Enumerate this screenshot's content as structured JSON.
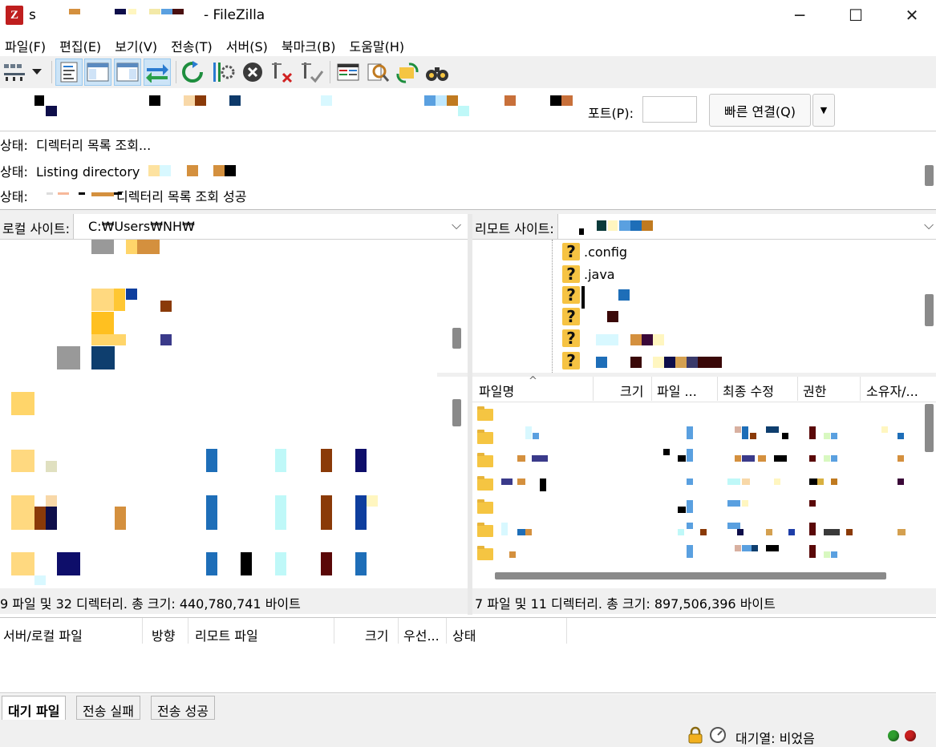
{
  "window": {
    "title_prefix": "s",
    "title_suffix": "- FileZilla",
    "app_icon": "Z",
    "minimize": "─",
    "maximize": "☐",
    "close": "✕"
  },
  "menu": [
    "파일(F)",
    "편집(E)",
    "보기(V)",
    "전송(T)",
    "서버(S)",
    "북마크(B)",
    "도움말(H)"
  ],
  "toolbar": {
    "icons": [
      "site-manager-icon",
      "dropdown-arrow-icon",
      "toggle-log-icon",
      "toggle-local-tree-icon",
      "toggle-remote-tree-icon",
      "toggle-queue-icon",
      "refresh-icon",
      "process-queue-icon",
      "cancel-icon",
      "disconnect-icon",
      "reconnect-icon",
      "directory-compare-icon",
      "filter-icon",
      "sync-browse-icon",
      "find-icon"
    ]
  },
  "quickconnect": {
    "port_label": "포트(P):",
    "port_value": "",
    "connect_label": "빠른 연결(Q)",
    "dropdown": "▼"
  },
  "log": [
    {
      "prefix": "상태:",
      "text": "디렉터리 목록 조회..."
    },
    {
      "prefix": "상태:",
      "text": "Listing directory"
    },
    {
      "prefix": "상태:",
      "text": "디렉터리 목록 조회 성공"
    }
  ],
  "local": {
    "label": "로컬 사이트:",
    "path": "C:₩Users₩NH₩",
    "status": "9 파일 및 32 디렉터리. 총 크기: 440,780,741 바이트"
  },
  "remote": {
    "label": "리모트 사이트:",
    "path": "",
    "tree": [
      ".config",
      ".java"
    ],
    "columns": [
      "파일명",
      "크기",
      "파일 ...",
      "최종 수정",
      "권한",
      "소유자/..."
    ],
    "sort_indicator": "^",
    "status": "7 파일 및 11 디렉터리. 총 크기: 897,506,396 바이트"
  },
  "queue": {
    "columns": [
      "서버/로컬 파일",
      "방향",
      "리모트 파일",
      "크기",
      "우선...",
      "상태"
    ]
  },
  "tabs": [
    "대기 파일",
    "전송 실패",
    "전송 성공"
  ],
  "statusbar": {
    "queue_text": "대기열: 비었음"
  },
  "colors": {
    "led_green": "#2e9e2e",
    "led_red": "#c81e1e",
    "folder": "#f5c542"
  }
}
